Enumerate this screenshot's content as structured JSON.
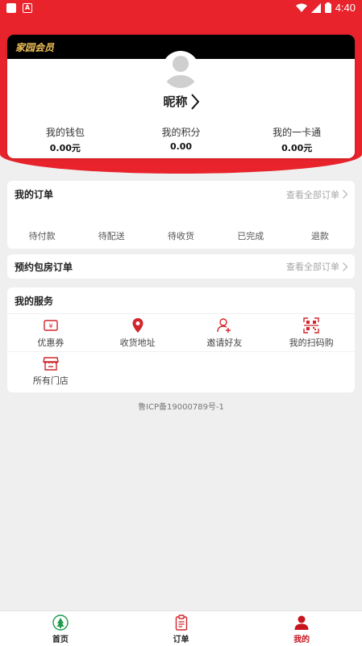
{
  "status_bar": {
    "time": "4:40"
  },
  "member_card": {
    "badge": "家园会员",
    "nickname": "昵称",
    "stats": [
      {
        "label": "我的钱包",
        "value": "0.00元"
      },
      {
        "label": "我的积分",
        "value": "0.00"
      },
      {
        "label": "我的一卡通",
        "value": "0.00元"
      }
    ]
  },
  "orders": {
    "title": "我的订单",
    "more": "查看全部订单",
    "tabs": [
      "待付款",
      "待配送",
      "待收货",
      "已完成",
      "退款"
    ]
  },
  "booking_orders": {
    "title": "预约包房订单",
    "more": "查看全部订单"
  },
  "services": {
    "title": "我的服务",
    "items": [
      {
        "label": "优惠券",
        "icon": "coupon-icon"
      },
      {
        "label": "收货地址",
        "icon": "location-pin-icon"
      },
      {
        "label": "邀请好友",
        "icon": "add-friend-icon"
      },
      {
        "label": "我的扫码购",
        "icon": "scan-icon"
      },
      {
        "label": "所有门店",
        "icon": "store-icon"
      }
    ]
  },
  "icp": "鲁ICP备19000789号-1",
  "tabbar": {
    "items": [
      {
        "label": "首页",
        "icon": "home-logo-icon",
        "active": false
      },
      {
        "label": "订单",
        "icon": "order-clipboard-icon",
        "active": false
      },
      {
        "label": "我的",
        "icon": "profile-icon",
        "active": true
      }
    ]
  },
  "colors": {
    "brand_red": "#e8232b",
    "gold": "#f2c35a",
    "active_tab": "#c8151d"
  }
}
